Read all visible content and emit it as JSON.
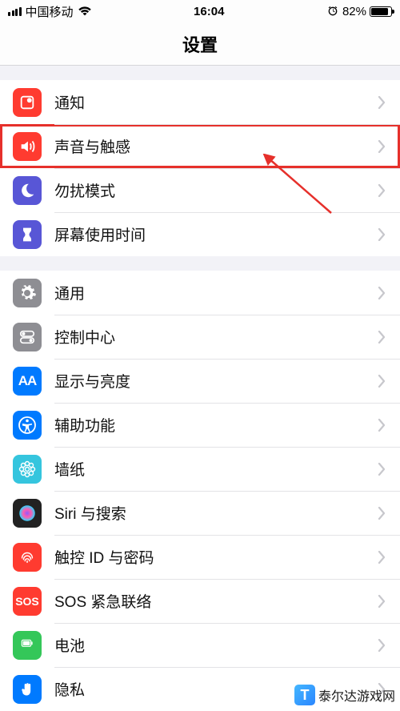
{
  "status": {
    "carrier": "中国移动",
    "time": "16:04",
    "battery_pct": "82%"
  },
  "nav": {
    "title": "设置"
  },
  "group1": [
    {
      "icon": "bell",
      "bg": "#ff3b30",
      "label": "通知",
      "highlight": false
    },
    {
      "icon": "sound",
      "bg": "#ff3b30",
      "label": "声音与触感",
      "highlight": true
    },
    {
      "icon": "moon",
      "bg": "#5856d6",
      "label": "勿扰模式",
      "highlight": false
    },
    {
      "icon": "hour",
      "bg": "#5856d6",
      "label": "屏幕使用时间",
      "highlight": false
    }
  ],
  "group2": [
    {
      "icon": "gear",
      "bg": "#8e8e93",
      "label": "通用"
    },
    {
      "icon": "toggle",
      "bg": "#8e8e93",
      "label": "控制中心"
    },
    {
      "icon": "AA",
      "bg": "#007aff",
      "label": "显示与亮度"
    },
    {
      "icon": "access",
      "bg": "#007aff",
      "label": "辅助功能"
    },
    {
      "icon": "flower",
      "bg": "#35c5de",
      "label": "墙纸"
    },
    {
      "icon": "siri",
      "bg": "#222",
      "label": "Siri 与搜索"
    },
    {
      "icon": "touchid",
      "bg": "#ff3b30",
      "label": "触控 ID 与密码"
    },
    {
      "icon": "sos",
      "bg": "#ff3b30",
      "label": "SOS 紧急联络"
    },
    {
      "icon": "battery",
      "bg": "#34c759",
      "label": "电池"
    },
    {
      "icon": "hand",
      "bg": "#007aff",
      "label": "隐私"
    }
  ],
  "watermark": {
    "text": "泰尔达游戏网"
  }
}
